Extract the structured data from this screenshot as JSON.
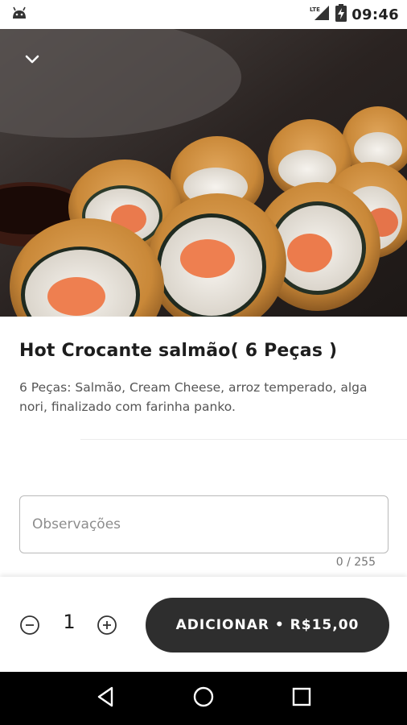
{
  "status_bar": {
    "time": "09:46",
    "network": "LTE",
    "icons": [
      "android-icon",
      "lte-signal-icon",
      "battery-charging-icon"
    ]
  },
  "product": {
    "image_alt": "Hot Crocante salmão",
    "title": "Hot Crocante salmão( 6 Peças )",
    "description": "6 Peças: Salmão, Cream Cheese, arroz temperado, alga nori, finalizado com farinha panko."
  },
  "observations": {
    "placeholder": "Observações",
    "value": "",
    "counter": "0 / 255"
  },
  "order": {
    "quantity": "1",
    "add_label": "ADICIONAR • R$15,00"
  },
  "colors": {
    "button_bg": "#2e2e2e",
    "nav_bg": "#000000"
  }
}
